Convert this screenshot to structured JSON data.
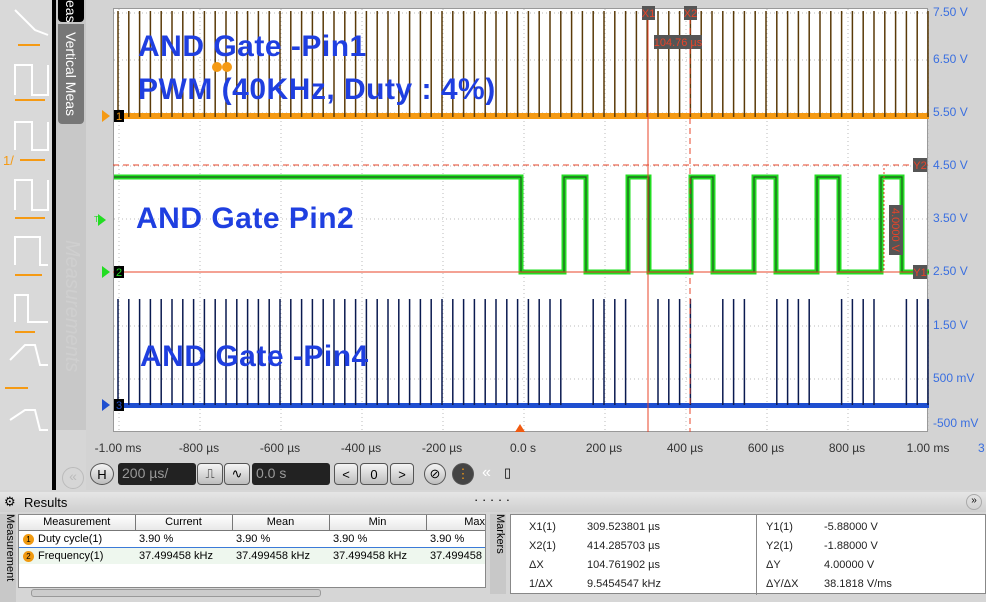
{
  "side_tabs": {
    "top_tab": "eas",
    "vertical_meas": "Vertical Meas",
    "watermark": "Measurements"
  },
  "titles": {
    "ch1_line1": "AND Gate -Pin1",
    "ch1_line2": "PWM (40KHz, Duty : 4%)",
    "ch2": "AND Gate Pin2",
    "ch3": "AND Gate -Pin4"
  },
  "channel_markers": [
    "1",
    "2",
    "3"
  ],
  "trigger_marker": "T",
  "y_axis_labels": [
    "7.50 V",
    "6.50 V",
    "5.50 V",
    "4.50 V",
    "3.50 V",
    "2.50 V",
    "1.50 V",
    "500 mV",
    "-500 mV"
  ],
  "x_axis_labels": [
    "-1.00 ms",
    "-800 µs",
    "-600 µs",
    "-400 µs",
    "-200 µs",
    "0.0 s",
    "200 µs",
    "400 µs",
    "600 µs",
    "800 µs",
    "1.00 ms"
  ],
  "x_axis_extra": "3",
  "cursors": {
    "x1": "X1",
    "x2": "X2",
    "dx_label": "104.76 µs",
    "y1": "Y1",
    "y2": "Y2",
    "dy_label": "4.0000 V",
    "color": "#e8442a"
  },
  "colors": {
    "ch1": "#f59a14",
    "ch1_trace": "#5a3a08",
    "ch2": "#22dd22",
    "ch2_trace": "#1f5a1f",
    "ch3": "#1f4fd0",
    "ch3_trace": "#0a1a50",
    "axis_label": "#3a6fe0"
  },
  "toolbar": {
    "h_button": "H",
    "timebase": "200 µs/",
    "position": "0.0 s",
    "zero_button": "0",
    "prev": "<",
    "next": ">"
  },
  "results": {
    "title": "Results",
    "side_tab": "Measurement",
    "columns": [
      "Measurement",
      "Current",
      "Mean",
      "Min",
      "Max"
    ],
    "rows": [
      {
        "badge": "1",
        "name": "Duty cycle(1)",
        "current": "3.90 %",
        "mean": "3.90 %",
        "min": "3.90 %",
        "max": "3.90 %"
      },
      {
        "badge": "2",
        "name": "Frequency(1)",
        "current": "37.499458 kHz",
        "mean": "37.499458 kHz",
        "min": "37.499458 kHz",
        "max": "37.499458"
      }
    ]
  },
  "markers": {
    "side_tab": "Markers",
    "left": [
      [
        "X1(1)",
        "309.523801 µs"
      ],
      [
        "X2(1)",
        "414.285703 µs"
      ],
      [
        "ΔX",
        "104.761902 µs"
      ],
      [
        "1/ΔX",
        "9.5454547 kHz"
      ]
    ],
    "right": [
      [
        "Y1(1)",
        "-5.88000 V"
      ],
      [
        "Y2(1)",
        "-1.88000 V"
      ],
      [
        "ΔY",
        "4.00000 V"
      ],
      [
        "ΔY/ΔX",
        "38.1818 V/ms"
      ]
    ]
  }
}
